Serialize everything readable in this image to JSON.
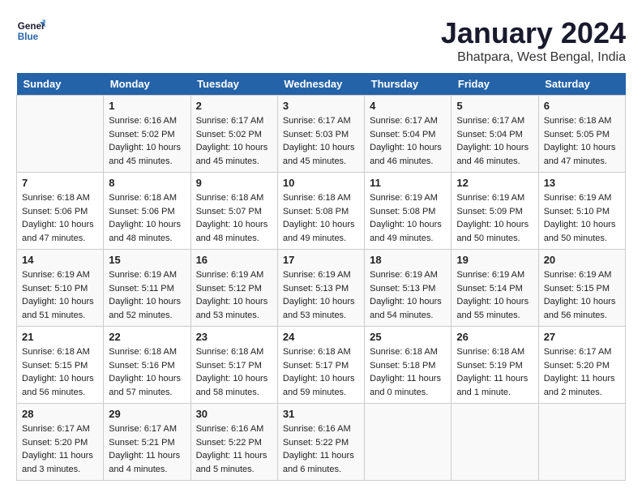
{
  "header": {
    "logo_line1": "General",
    "logo_line2": "Blue",
    "month_year": "January 2024",
    "location": "Bhatpara, West Bengal, India"
  },
  "days_of_week": [
    "Sunday",
    "Monday",
    "Tuesday",
    "Wednesday",
    "Thursday",
    "Friday",
    "Saturday"
  ],
  "weeks": [
    [
      {
        "day": "",
        "info": ""
      },
      {
        "day": "1",
        "info": "Sunrise: 6:16 AM\nSunset: 5:02 PM\nDaylight: 10 hours\nand 45 minutes."
      },
      {
        "day": "2",
        "info": "Sunrise: 6:17 AM\nSunset: 5:02 PM\nDaylight: 10 hours\nand 45 minutes."
      },
      {
        "day": "3",
        "info": "Sunrise: 6:17 AM\nSunset: 5:03 PM\nDaylight: 10 hours\nand 45 minutes."
      },
      {
        "day": "4",
        "info": "Sunrise: 6:17 AM\nSunset: 5:04 PM\nDaylight: 10 hours\nand 46 minutes."
      },
      {
        "day": "5",
        "info": "Sunrise: 6:17 AM\nSunset: 5:04 PM\nDaylight: 10 hours\nand 46 minutes."
      },
      {
        "day": "6",
        "info": "Sunrise: 6:18 AM\nSunset: 5:05 PM\nDaylight: 10 hours\nand 47 minutes."
      }
    ],
    [
      {
        "day": "7",
        "info": "Sunrise: 6:18 AM\nSunset: 5:06 PM\nDaylight: 10 hours\nand 47 minutes."
      },
      {
        "day": "8",
        "info": "Sunrise: 6:18 AM\nSunset: 5:06 PM\nDaylight: 10 hours\nand 48 minutes."
      },
      {
        "day": "9",
        "info": "Sunrise: 6:18 AM\nSunset: 5:07 PM\nDaylight: 10 hours\nand 48 minutes."
      },
      {
        "day": "10",
        "info": "Sunrise: 6:18 AM\nSunset: 5:08 PM\nDaylight: 10 hours\nand 49 minutes."
      },
      {
        "day": "11",
        "info": "Sunrise: 6:19 AM\nSunset: 5:08 PM\nDaylight: 10 hours\nand 49 minutes."
      },
      {
        "day": "12",
        "info": "Sunrise: 6:19 AM\nSunset: 5:09 PM\nDaylight: 10 hours\nand 50 minutes."
      },
      {
        "day": "13",
        "info": "Sunrise: 6:19 AM\nSunset: 5:10 PM\nDaylight: 10 hours\nand 50 minutes."
      }
    ],
    [
      {
        "day": "14",
        "info": "Sunrise: 6:19 AM\nSunset: 5:10 PM\nDaylight: 10 hours\nand 51 minutes."
      },
      {
        "day": "15",
        "info": "Sunrise: 6:19 AM\nSunset: 5:11 PM\nDaylight: 10 hours\nand 52 minutes."
      },
      {
        "day": "16",
        "info": "Sunrise: 6:19 AM\nSunset: 5:12 PM\nDaylight: 10 hours\nand 53 minutes."
      },
      {
        "day": "17",
        "info": "Sunrise: 6:19 AM\nSunset: 5:13 PM\nDaylight: 10 hours\nand 53 minutes."
      },
      {
        "day": "18",
        "info": "Sunrise: 6:19 AM\nSunset: 5:13 PM\nDaylight: 10 hours\nand 54 minutes."
      },
      {
        "day": "19",
        "info": "Sunrise: 6:19 AM\nSunset: 5:14 PM\nDaylight: 10 hours\nand 55 minutes."
      },
      {
        "day": "20",
        "info": "Sunrise: 6:19 AM\nSunset: 5:15 PM\nDaylight: 10 hours\nand 56 minutes."
      }
    ],
    [
      {
        "day": "21",
        "info": "Sunrise: 6:18 AM\nSunset: 5:15 PM\nDaylight: 10 hours\nand 56 minutes."
      },
      {
        "day": "22",
        "info": "Sunrise: 6:18 AM\nSunset: 5:16 PM\nDaylight: 10 hours\nand 57 minutes."
      },
      {
        "day": "23",
        "info": "Sunrise: 6:18 AM\nSunset: 5:17 PM\nDaylight: 10 hours\nand 58 minutes."
      },
      {
        "day": "24",
        "info": "Sunrise: 6:18 AM\nSunset: 5:17 PM\nDaylight: 10 hours\nand 59 minutes."
      },
      {
        "day": "25",
        "info": "Sunrise: 6:18 AM\nSunset: 5:18 PM\nDaylight: 11 hours\nand 0 minutes."
      },
      {
        "day": "26",
        "info": "Sunrise: 6:18 AM\nSunset: 5:19 PM\nDaylight: 11 hours\nand 1 minute."
      },
      {
        "day": "27",
        "info": "Sunrise: 6:17 AM\nSunset: 5:20 PM\nDaylight: 11 hours\nand 2 minutes."
      }
    ],
    [
      {
        "day": "28",
        "info": "Sunrise: 6:17 AM\nSunset: 5:20 PM\nDaylight: 11 hours\nand 3 minutes."
      },
      {
        "day": "29",
        "info": "Sunrise: 6:17 AM\nSunset: 5:21 PM\nDaylight: 11 hours\nand 4 minutes."
      },
      {
        "day": "30",
        "info": "Sunrise: 6:16 AM\nSunset: 5:22 PM\nDaylight: 11 hours\nand 5 minutes."
      },
      {
        "day": "31",
        "info": "Sunrise: 6:16 AM\nSunset: 5:22 PM\nDaylight: 11 hours\nand 6 minutes."
      },
      {
        "day": "",
        "info": ""
      },
      {
        "day": "",
        "info": ""
      },
      {
        "day": "",
        "info": ""
      }
    ]
  ]
}
